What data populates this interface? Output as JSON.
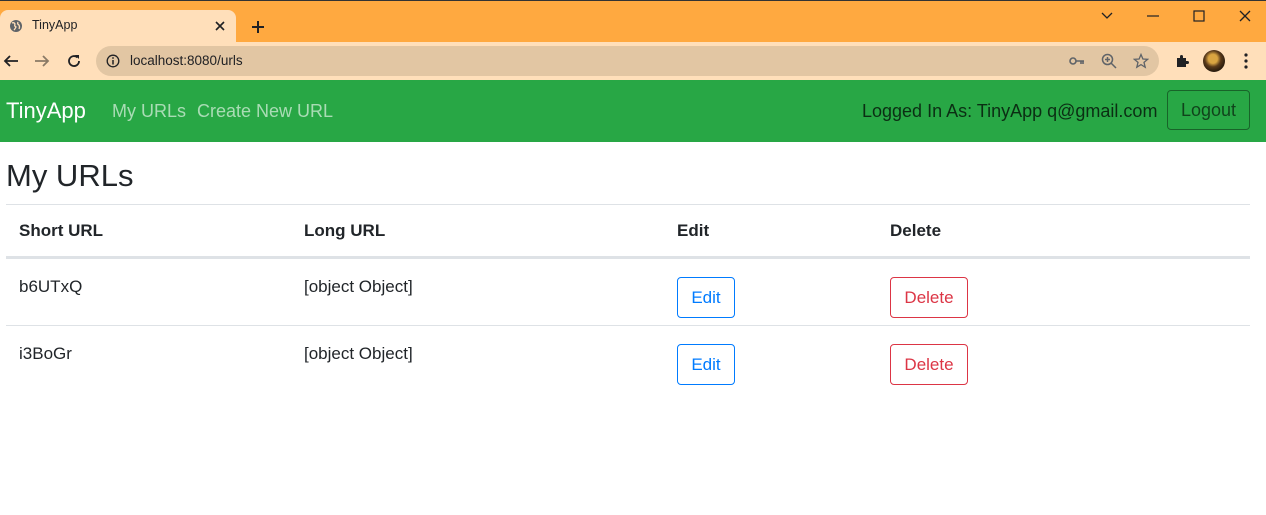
{
  "browser": {
    "tab_title": "TinyApp",
    "url": "localhost:8080/urls",
    "icons": {
      "favicon": "globe-icon",
      "close": "close-icon",
      "new_tab": "plus-icon",
      "back": "back-arrow-icon",
      "forward": "forward-arrow-icon",
      "reload": "reload-icon",
      "site_info": "info-icon",
      "passwords": "key-icon",
      "zoom": "zoom-icon",
      "bookmark": "star-icon",
      "extensions": "puzzle-icon",
      "menu": "kebab-menu-icon"
    },
    "colors": {
      "tabstrip": "#ffa940",
      "toolbar": "#ffdfba",
      "omnibox": "#e2c6a3"
    }
  },
  "navbar": {
    "brand": "TinyApp",
    "links": [
      "My URLs",
      "Create New URL"
    ],
    "logged_in_text": "Logged In As: TinyApp q@gmail.com",
    "logout_label": "Logout",
    "color": "#28a745"
  },
  "main": {
    "title": "My URLs",
    "table": {
      "headers": [
        "Short URL",
        "Long URL",
        "Edit",
        "Delete"
      ],
      "rows": [
        {
          "short_url": "b6UTxQ",
          "long_url": "[object Object]",
          "edit_label": "Edit",
          "delete_label": "Delete"
        },
        {
          "short_url": "i3BoGr",
          "long_url": "[object Object]",
          "edit_label": "Edit",
          "delete_label": "Delete"
        }
      ]
    },
    "colors": {
      "edit": "#007bff",
      "delete": "#dc3545"
    }
  }
}
